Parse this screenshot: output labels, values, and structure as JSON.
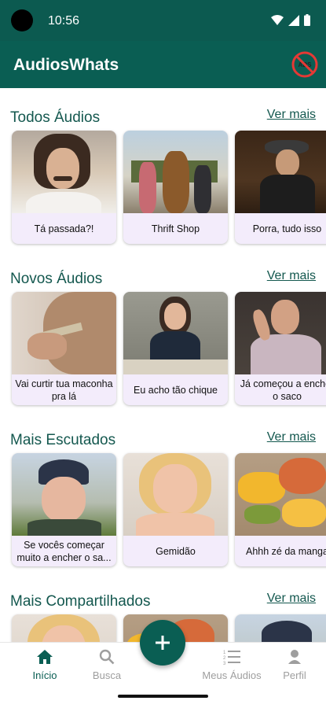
{
  "status": {
    "time": "10:56"
  },
  "app": {
    "title": "AudiosWhats",
    "noads_label": "ADS"
  },
  "sections": [
    {
      "title": "Todos Áudios",
      "see_more": "Ver mais",
      "cards": [
        {
          "caption": "Tá passada?!"
        },
        {
          "caption": "Thrift Shop"
        },
        {
          "caption": "Porra, tudo isso"
        }
      ]
    },
    {
      "title": "Novos Áudios",
      "see_more": "Ver mais",
      "cards": [
        {
          "caption": "Vai curtir tua maconha pra lá"
        },
        {
          "caption": "Eu acho tão chique"
        },
        {
          "caption": "Já começou a encher o saco"
        }
      ]
    },
    {
      "title": "Mais Escutados",
      "see_more": "Ver mais",
      "cards": [
        {
          "caption": "Se vocês começar muito a encher o sa..."
        },
        {
          "caption": "Gemidão"
        },
        {
          "caption": "Ahhh zé da manga"
        }
      ]
    },
    {
      "title": "Mais Compartilhados",
      "see_more": "Ver mais",
      "cards": [
        {
          "caption": ""
        },
        {
          "caption": ""
        },
        {
          "caption": ""
        }
      ]
    }
  ],
  "nav": {
    "home": "Início",
    "search": "Busca",
    "my_audios": "Meus Áudios",
    "profile": "Perfil"
  },
  "colors": {
    "primary": "#0a5e53",
    "status_bar": "#0c5a50",
    "card_bg": "#f3ecfb"
  }
}
